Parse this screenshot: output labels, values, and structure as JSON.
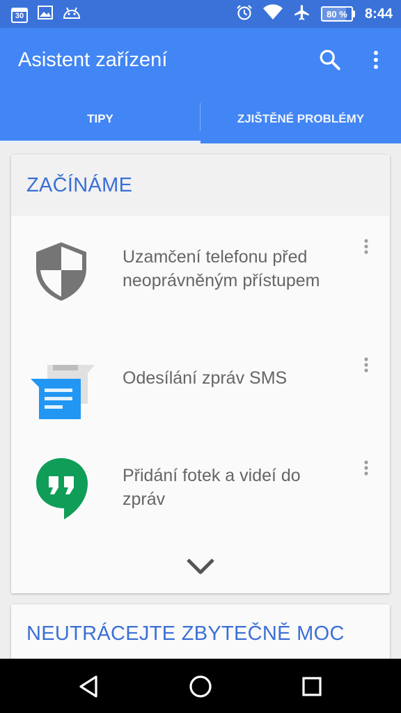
{
  "status_bar": {
    "calendar_day": "30",
    "battery_percent": "80 %",
    "battery_level": 0.8,
    "time": "8:44",
    "icons": [
      "calendar-icon",
      "image-icon",
      "android-icon",
      "alarm-icon",
      "wifi-icon",
      "airplane-icon",
      "battery-icon"
    ]
  },
  "app_bar": {
    "title": "Asistent zařízení",
    "icons": [
      "search-icon",
      "more-vert-icon"
    ]
  },
  "tabs": [
    {
      "label": "TIPY",
      "selected": true
    },
    {
      "label": "ZJIŠTĚNÉ PROBLÉMY",
      "selected": false
    }
  ],
  "cards": [
    {
      "title": "ZAČÍNÁME",
      "items": [
        {
          "text": "Uzamčení telefonu před neoprávněným přístupem",
          "icon": "shield-icon"
        },
        {
          "text": "Odesílání zpráv SMS",
          "icon": "messages-icon"
        },
        {
          "text": "Přidání fotek a videí do zpráv",
          "icon": "hangouts-icon"
        }
      ],
      "expand_icon": "chevron-down-icon"
    },
    {
      "title": "NEUTRÁCEJTE ZBYTEČNĚ MOC"
    }
  ],
  "nav_bar": {
    "icons": [
      "back-icon",
      "home-icon",
      "recents-icon"
    ]
  },
  "colors": {
    "status_bar": "#3a72d9",
    "app_bar": "#4285f4",
    "card_title": "#3b6fd6",
    "shield": "#757575",
    "messages_blue": "#2196f3",
    "hangouts_green": "#0f9d58"
  }
}
